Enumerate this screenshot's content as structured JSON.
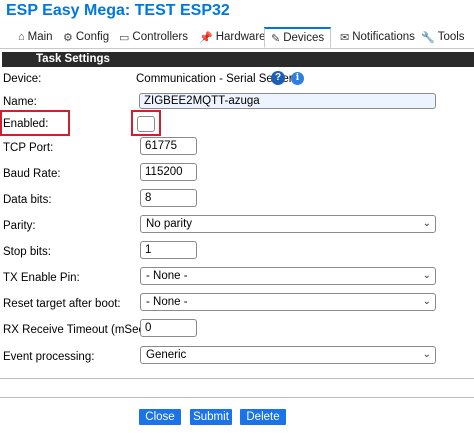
{
  "page_title": "ESP Easy Mega: TEST ESP32",
  "tabs": [
    {
      "label": "Main",
      "icon": "⌂"
    },
    {
      "label": "Config",
      "icon": "⚙"
    },
    {
      "label": "Controllers",
      "icon": "▭"
    },
    {
      "label": "Hardware",
      "icon": "📌"
    },
    {
      "label": "Devices",
      "icon": "✎"
    },
    {
      "label": "Notifications",
      "icon": "✉"
    },
    {
      "label": "Tools",
      "icon": "🔧"
    }
  ],
  "active_tab": "Devices",
  "section_header": "Task Settings",
  "device": {
    "label": "Device:",
    "value": "Communication - Serial Server",
    "help_glyph": "?",
    "info_glyph": "i"
  },
  "name": {
    "label": "Name:",
    "value": "ZIGBEE2MQTT-azuga"
  },
  "enabled": {
    "label": "Enabled:",
    "checked": false
  },
  "tcp_port": {
    "label": "TCP Port:",
    "value": "61775"
  },
  "baud_rate": {
    "label": "Baud Rate:",
    "value": "115200"
  },
  "data_bits": {
    "label": "Data bits:",
    "value": "8"
  },
  "parity": {
    "label": "Parity:",
    "value": "No parity"
  },
  "stop_bits": {
    "label": "Stop bits:",
    "value": "1"
  },
  "tx_enable_pin": {
    "label": "TX Enable Pin:",
    "value": "- None -"
  },
  "reset_target": {
    "label": "Reset target after boot:",
    "value": "- None -"
  },
  "rx_timeout": {
    "label": "RX Receive Timeout (mSec):",
    "value": "0"
  },
  "event_processing": {
    "label": "Event processing:",
    "value": "Generic"
  },
  "buttons": {
    "close": "Close",
    "submit": "Submit",
    "delete": "Delete"
  },
  "colors": {
    "accent": "#0077dd",
    "button": "#1a73e8",
    "highlight": "#d0202e",
    "header": "#2a2a2a"
  }
}
